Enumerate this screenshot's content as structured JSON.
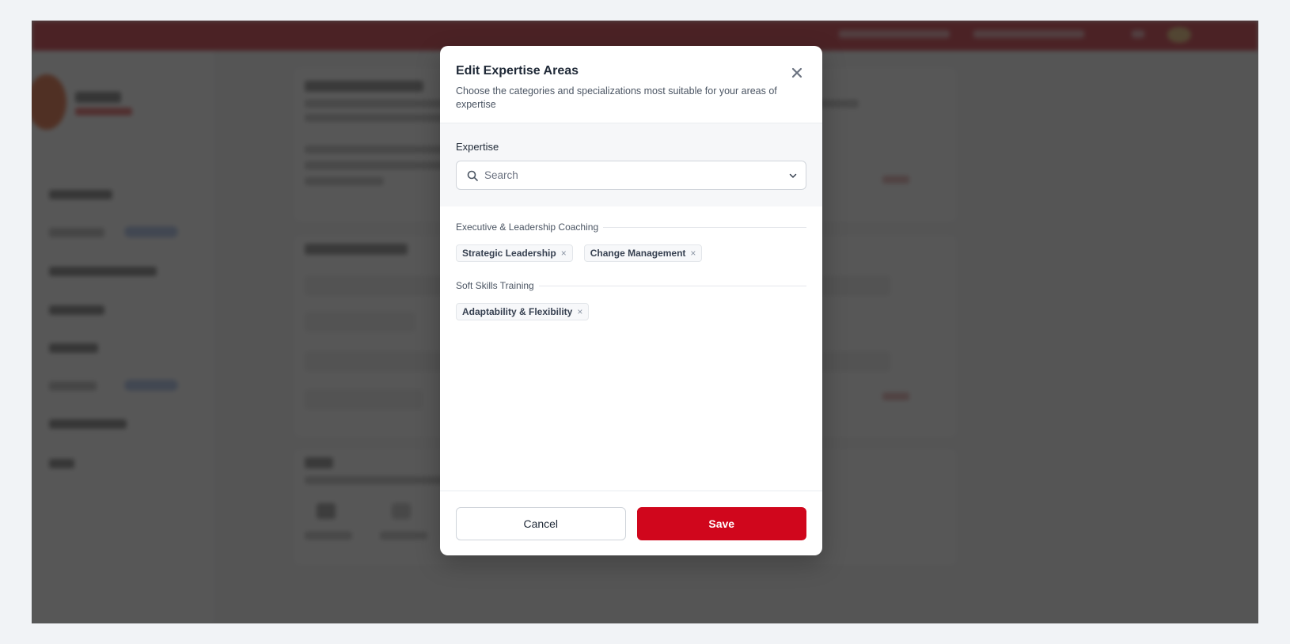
{
  "modal": {
    "title": "Edit Expertise Areas",
    "subtitle": "Choose the categories and specializations most suitable for your areas of expertise",
    "field_label": "Expertise",
    "search_placeholder": "Search",
    "groups": [
      {
        "title": "Executive & Leadership Coaching",
        "chips": [
          "Strategic Leadership",
          "Change Management"
        ]
      },
      {
        "title": "Soft Skills Training",
        "chips": [
          "Adaptability & Flexibility"
        ]
      }
    ],
    "chip_remove_glyph": "×",
    "cancel_label": "Cancel",
    "save_label": "Save"
  },
  "colors": {
    "brand_red": "#d0061c",
    "overlay": "rgba(40,40,40,0.78)"
  },
  "icons": [
    "search-icon",
    "chevron-down-icon",
    "close-icon"
  ]
}
